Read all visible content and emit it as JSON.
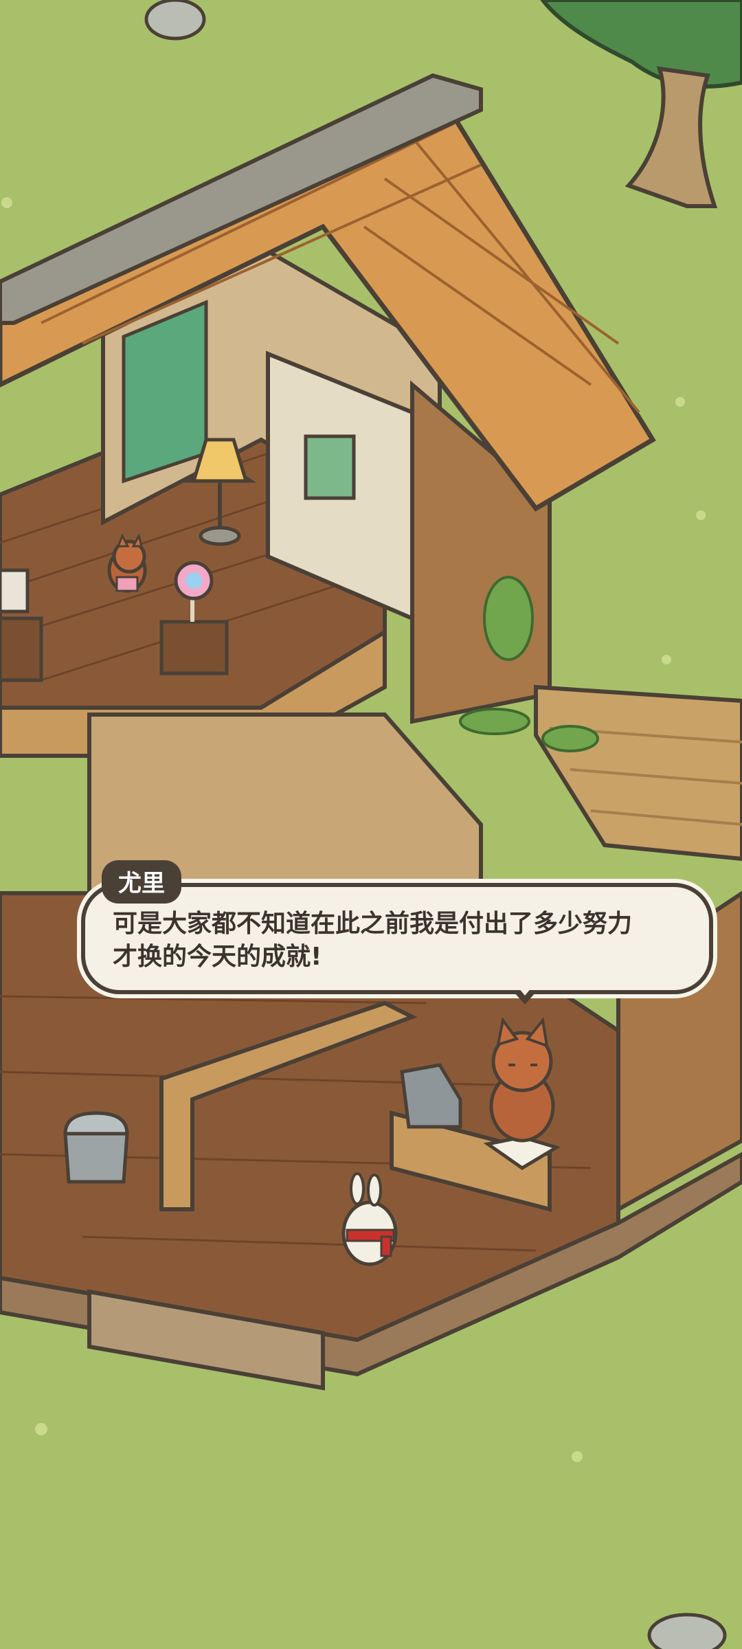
{
  "dialog": {
    "speaker": "尤里",
    "line1": "可是大家都不知道在此之前我是付出了多少努力",
    "line2": "才换的今天的成就!"
  },
  "colors": {
    "grass": "#a8c06a",
    "roof_tile": "#d89a52",
    "wood_floor": "#8a5a38",
    "wall": "#d2b88e",
    "outline": "#4a4036",
    "dialog_bg": "#f5f1e6"
  },
  "icons": [
    "rock-icon",
    "tree-icon",
    "lamp-icon",
    "lollipop-icon",
    "squirrel-icon",
    "fox-icon",
    "rabbit-icon",
    "cash-register-icon",
    "book-icon",
    "trash-can-icon"
  ]
}
